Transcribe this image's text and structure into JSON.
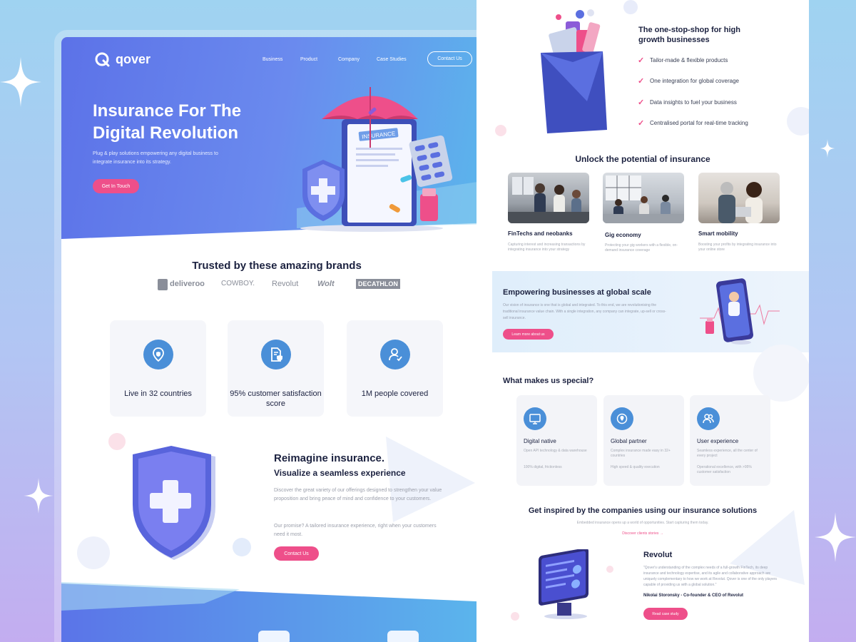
{
  "left_page": {
    "brand": "qover",
    "nav": [
      "Business",
      "Product",
      "Company",
      "Case Studies"
    ],
    "nav_cta": "Contact Us",
    "hero": {
      "title": "Insurance For The Digital Revolution",
      "subtitle": "Plug & play solutions empowering any digital business to integrate insurance into its strategy.",
      "cta": "Get In Touch",
      "clipboard_label": "INSURANCE"
    },
    "trusted_title": "Trusted by these amazing brands",
    "brands": [
      "deliveroo",
      "COWBOY.",
      "Revolut",
      "Wolt",
      "DECATHLON"
    ],
    "stats": [
      {
        "icon": "location-shield-icon",
        "label": "Live in 32 countries"
      },
      {
        "icon": "document-shield-icon",
        "label": "95% customer satisfaction score"
      },
      {
        "icon": "user-check-icon",
        "label": "1M people covered"
      }
    ],
    "reimagine": {
      "title": "Reimagine insurance.",
      "subtitle": "Visualize a seamless experience",
      "p1": "Discover the great variety of our offerings designed to strengthen your value proposition and bring peace of mind and confidence to your customers.",
      "p2": "Our promise? A tailored insurance experience, right when your customers need it most.",
      "cta": "Contact Us"
    }
  },
  "right_page": {
    "one_stop": {
      "title": "The one-stop-shop for high growth businesses",
      "features": [
        "Tailor-made & flexible products",
        "One integration for global coverage",
        "Data insights to fuel your business",
        "Centralised portal for real-time tracking"
      ]
    },
    "unlock": {
      "title": "Unlock the potential of insurance",
      "items": [
        {
          "title": "FinTechs and neobanks",
          "desc": "Capturing interest and increasing transactions by integrating insurance into your strategy"
        },
        {
          "title": "Gig economy",
          "desc": "Protecting your gig workers with a flexible, on-demand insurance coverage"
        },
        {
          "title": "Smart mobility",
          "desc": "Boosting your profits by integrating insurance into your online store"
        }
      ]
    },
    "empower": {
      "title": "Empowering businesses at global scale",
      "desc": "Our vision of insurance is one that is global and integrated. To this end, we are revolutionising the traditional insurance value chain. With a single integration, any company can integrate, up-sell or cross-sell insurance.",
      "cta": "Learn more about us"
    },
    "special": {
      "title": "What makes us special?",
      "cards": [
        {
          "icon": "monitor-icon",
          "title": "Digital native",
          "bullets": [
            "Open API technology & data warehouse",
            "100% digital, frictionless"
          ]
        },
        {
          "icon": "globe-pin-icon",
          "title": "Global partner",
          "bullets": [
            "Complex insurance made easy in 32+ countries",
            "High speed & quality execution"
          ]
        },
        {
          "icon": "users-icon",
          "title": "User experience",
          "bullets": [
            "Seamless experience, all the center of every project",
            "Operational excellence, with >95% customer satisfaction"
          ]
        }
      ]
    },
    "inspired": {
      "title": "Get inspired by the companies using our insurance solutions",
      "sub": "Embedded insurance opens up a world of opportunities. Start capturing them today.",
      "link": "Discover clients stories",
      "case_title": "Revolut",
      "quote": "\"Qover's understanding of the complex needs of a full-growth FinTech, its deep insurance and technology expertise, and its agile and collaborative approach are uniquely complementary to how we work at Revolut. Qover is one of the only players capable of providing us with a global solution.\"",
      "author": "Nikolai Storonsky - Co-founder & CEO of Revolut",
      "cta": "Read case study"
    }
  }
}
